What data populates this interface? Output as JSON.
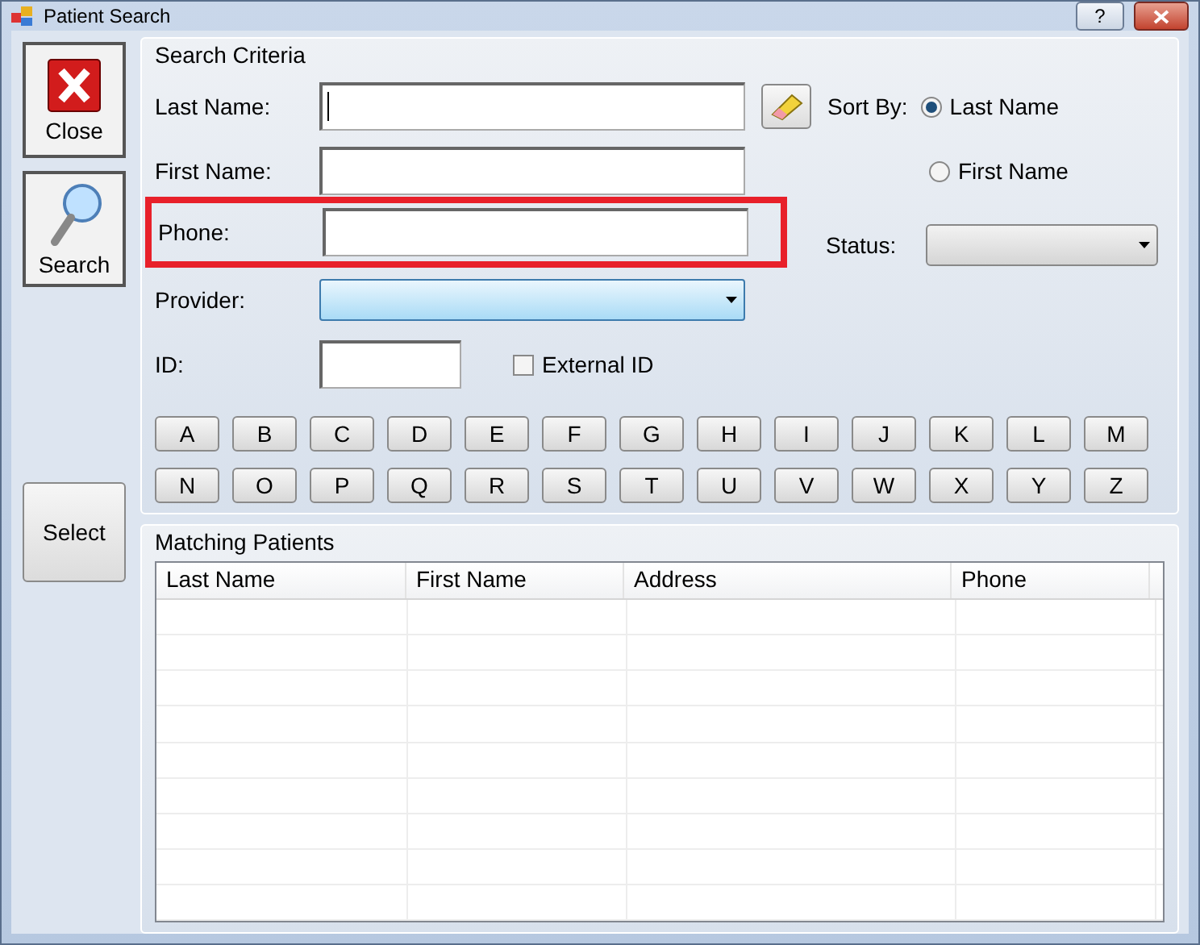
{
  "window": {
    "title": "Patient Search",
    "help_button": "?"
  },
  "side_buttons": [
    {
      "label": "Close",
      "kind": "close"
    },
    {
      "label": "Search",
      "kind": "search"
    },
    {
      "label": "Select",
      "kind": "plain"
    }
  ],
  "search_criteria": {
    "title": "Search Criteria",
    "fields": [
      {
        "label": "Last Name:",
        "kind": "text",
        "focused": true,
        "highlighted": false
      },
      {
        "label": "First Name:",
        "kind": "text",
        "focused": false,
        "highlighted": false
      },
      {
        "label": "Phone:",
        "kind": "text",
        "focused": false,
        "highlighted": true
      },
      {
        "label": "Provider:",
        "kind": "dropdown",
        "focused": false,
        "highlighted": false
      },
      {
        "label": "ID:",
        "kind": "short",
        "focused": false,
        "highlighted": false
      }
    ],
    "external_id": {
      "label": "External ID",
      "checked": false
    },
    "sort_by": {
      "label": "Sort By:",
      "options": [
        {
          "label": "Last Name",
          "selected": true
        },
        {
          "label": "First Name",
          "selected": false
        }
      ]
    },
    "status": {
      "label": "Status:"
    },
    "letters": [
      "A",
      "B",
      "C",
      "D",
      "E",
      "F",
      "G",
      "H",
      "I",
      "J",
      "K",
      "L",
      "M",
      "N",
      "O",
      "P",
      "Q",
      "R",
      "S",
      "T",
      "U",
      "V",
      "W",
      "X",
      "Y",
      "Z"
    ]
  },
  "matching_patients": {
    "title": "Matching Patients",
    "columns": [
      "Last Name",
      "First Name",
      "Address",
      "Phone"
    ]
  }
}
